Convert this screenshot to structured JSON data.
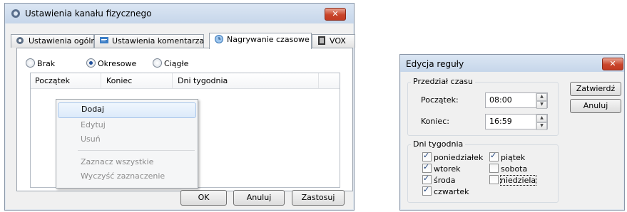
{
  "main_window": {
    "title": "Ustawienia kanału fizycznego",
    "close_label": "✕",
    "tabs": [
      {
        "label": "Ustawienia ogólne",
        "icon": "gear-icon"
      },
      {
        "label": "Ustawienia komentarza",
        "icon": "comment-icon"
      },
      {
        "label": "Nagrywanie czasowe",
        "icon": "clock-icon"
      },
      {
        "label": "VOX",
        "icon": "film-icon"
      }
    ],
    "radios": [
      {
        "label": "Brak",
        "selected": false
      },
      {
        "label": "Okresowe",
        "selected": true
      },
      {
        "label": "Ciągłe",
        "selected": false
      }
    ],
    "list_columns": [
      "Początek",
      "Koniec",
      "Dni tygodnia"
    ],
    "context_menu": [
      {
        "label": "Dodaj",
        "enabled": true
      },
      {
        "label": "Edytuj",
        "enabled": false
      },
      {
        "label": "Usuń",
        "enabled": false
      },
      {
        "label": "Zaznacz wszystkie",
        "enabled": false
      },
      {
        "label": "Wyczyść zaznaczenie",
        "enabled": false
      }
    ],
    "buttons": {
      "ok": "OK",
      "cancel": "Anuluj",
      "apply": "Zastosuj"
    }
  },
  "rule_dialog": {
    "title": "Edycja reguły",
    "close_label": "✕",
    "time_group": {
      "label": "Przedział czasu",
      "start_label": "Początek:",
      "start_value": "08:00",
      "end_label": "Koniec:",
      "end_value": "16:59"
    },
    "days_group": {
      "label": "Dni tygodnia",
      "days": [
        {
          "label": "poniedziałek",
          "checked": true
        },
        {
          "label": "wtorek",
          "checked": true
        },
        {
          "label": "środa",
          "checked": true
        },
        {
          "label": "czwartek",
          "checked": true
        },
        {
          "label": "piątek",
          "checked": true
        },
        {
          "label": "sobota",
          "checked": false
        },
        {
          "label": "niedziela",
          "checked": false
        }
      ]
    },
    "buttons": {
      "confirm": "Zatwierdź",
      "cancel": "Anuluj"
    }
  }
}
